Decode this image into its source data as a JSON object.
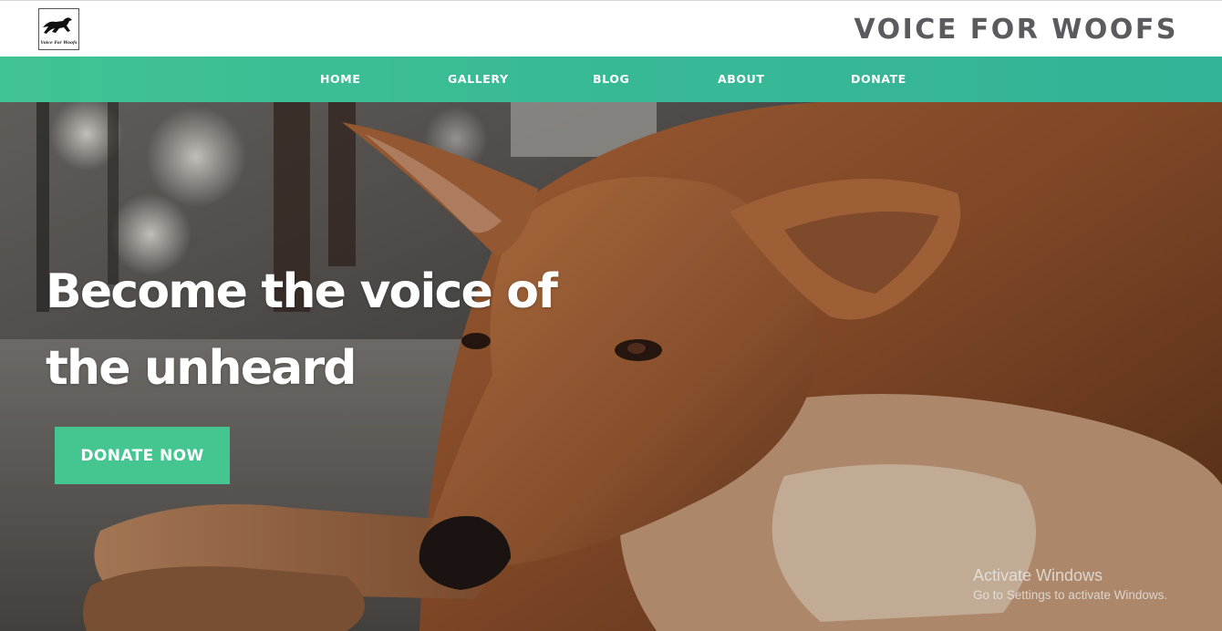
{
  "header": {
    "logo_text": "Voice For Woofs",
    "site_title": "VOICE FOR WOOFS"
  },
  "nav": {
    "items": [
      {
        "label": "HOME"
      },
      {
        "label": "GALLERY"
      },
      {
        "label": "BLOG"
      },
      {
        "label": "ABOUT"
      },
      {
        "label": "DONATE"
      }
    ]
  },
  "hero": {
    "headline_line1": "Become the voice of",
    "headline_line2": "the unheard",
    "donate_button": "DONATE NOW",
    "image": "dog-photo"
  },
  "watermark": {
    "title": "Activate Windows",
    "subtitle": "Go to Settings to activate Windows."
  },
  "colors": {
    "nav_green": "#38b996",
    "button_green": "#45c590",
    "title_gray": "#5a5a5f"
  }
}
